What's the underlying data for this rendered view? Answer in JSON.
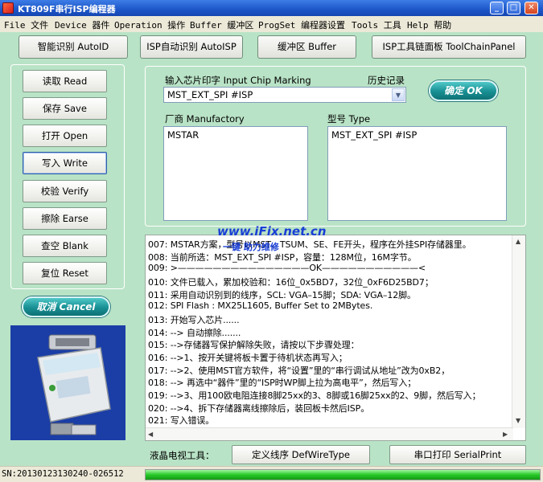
{
  "window": {
    "title": "KT809F串行ISP编程器",
    "minimize_glyph": "_",
    "maximize_glyph": "□",
    "close_glyph": "✕"
  },
  "menu": [
    "File 文件",
    "Device 器件",
    "Operation 操作",
    "Buffer 缓冲区",
    "ProgSet 编程器设置",
    "Tools 工具",
    "Help 帮助"
  ],
  "top_buttons": {
    "auto_id": "智能识别 AutoID",
    "auto_isp": "ISP自动识别 AutoISP",
    "buffer": "缓冲区 Buffer",
    "toolchain": "ISP工具链面板 ToolChainPanel"
  },
  "actions": {
    "read": "读取 Read",
    "save": "保存 Save",
    "open": "打开 Open",
    "write": "写入 Write",
    "verify": "校验 Verify",
    "erase": "擦除 Earse",
    "blank": "查空 Blank",
    "reset": "复位 Reset"
  },
  "cancel_button": "取消 Cancel",
  "chip": {
    "marking_label": "输入芯片印字 Input Chip Marking",
    "history_label": "历史记录",
    "marking_value": "MST_EXT_SPI #ISP",
    "ok_button": "确定 OK",
    "manufactory_label": "厂商 Manufactory",
    "manufactory_items": [
      "MSTAR"
    ],
    "type_label": "型号 Type",
    "type_items": [
      "MST_EXT_SPI #ISP"
    ]
  },
  "watermark": {
    "site": "www.iFix.net.cn",
    "slogan": "一键   助力维修"
  },
  "log": [
    "007: MSTAR方案，型号以MST、TSUM、SE、FE开头，程序在外挂SPI存储器里。",
    "008: 当前所选：MST_EXT_SPI #ISP，容量：128M位，16M字节。",
    "009: >———————————————OK———————————<",
    "010: 文件已载入，累加校验和：16位_0x5BD7，32位_0xF6D25BD7；",
    "011: 采用自动识别到的线序，SCL: VGA–15脚；SDA: VGA–12脚。",
    "012: SPI Flash : MX25L1605, Buffer Set to 2MBytes.",
    "013: 开始写入芯片......",
    "014: --> 自动擦除.......",
    "015: -->存储器写保护解除失败，请按以下步骤处理：",
    "016: -->1、按开关键将板卡置于待机状态再写入；",
    "017: -->2、使用MST官方软件，将“设置”里的“串行调试从地址”改为0xB2，",
    "018: -->     再选中“器件”里的“ISP时WP脚上拉为高电平”，然后写入；",
    "019: -->3、用100欧电阻连接8脚25xx的3、8脚或16脚25xx的2、9脚，然后写入；",
    "020: -->4、拆下存储器离线擦除后，装回板卡然后ISP。",
    "021: 写入错误。"
  ],
  "scroll": {
    "up": "▲",
    "down": "▼",
    "left": "◀",
    "right": "▶"
  },
  "bottom": {
    "lcd_tools_label": "液晶电视工具：",
    "def_wire_button": "定义线序  DefWireType",
    "serial_print_button": "串口打印  SerialPrint"
  },
  "photo": {
    "device_text": "KT809F Serial ISP Programmer"
  },
  "status": {
    "serial": "SN:20130123130240-026512",
    "progress": 1.0
  }
}
